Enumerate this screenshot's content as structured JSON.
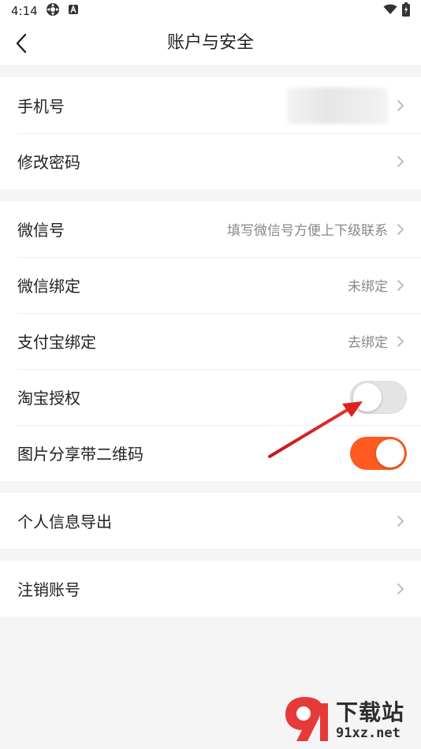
{
  "status_bar": {
    "time": "4:14",
    "icons": [
      "settings-gear-icon",
      "a-notification-icon"
    ],
    "right_icons": [
      "wifi-icon",
      "battery-charging-icon"
    ]
  },
  "app_bar": {
    "back_icon": "chevron-left-icon",
    "title": "账户与安全"
  },
  "groups": {
    "account": {
      "phone_label": "手机号",
      "change_password_label": "修改密码"
    },
    "binding": {
      "wechat_id_label": "微信号",
      "wechat_id_placeholder": "填写微信号方便上下级联系",
      "wechat_bind_label": "微信绑定",
      "wechat_bind_value": "未绑定",
      "alipay_bind_label": "支付宝绑定",
      "alipay_bind_value": "去绑定",
      "taobao_auth_label": "淘宝授权",
      "taobao_auth_enabled": false,
      "qr_share_label": "图片分享带二维码",
      "qr_share_enabled": true
    },
    "export": {
      "label": "个人信息导出"
    },
    "cancel": {
      "label": "注销账号"
    }
  },
  "colors": {
    "accent": "#ff5a1f",
    "annotation_arrow": "#e0201b",
    "toggle_off": "#e4e4e4"
  },
  "watermark": {
    "title": "下载站",
    "url": "91xz.net"
  }
}
